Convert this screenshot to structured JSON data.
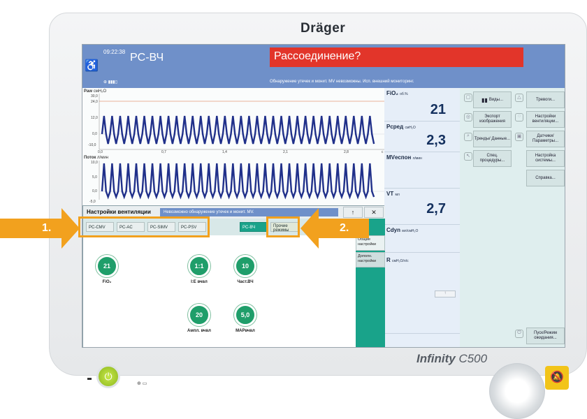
{
  "device": {
    "brand": "Dräger",
    "model_main": "Infinity",
    "model_sub": "C500"
  },
  "header": {
    "time": "09:22:38",
    "mode": "PC-ВЧ",
    "alarm": "Рассоединение?",
    "alarm_message": "Обнаружение утечек и монит. MV невозможны. Исп. внешний мониторинг."
  },
  "waves": {
    "paw_label": "Paw",
    "paw_unit": "смH₂O",
    "paw_ticks": [
      "30,0",
      "24,0",
      "12,0",
      "0,0",
      "-10,0"
    ],
    "time_ticks": [
      "0,0",
      "0,7",
      "1,4",
      "2,1",
      "2,8",
      "с"
    ],
    "flow_label": "Поток",
    "flow_unit": "л/мин",
    "flow_ticks": [
      "10,0",
      "5,0",
      "0,0",
      "-5,0"
    ]
  },
  "params": [
    {
      "name": "FiO₂",
      "unit": "об.%",
      "value": "21"
    },
    {
      "name": "Pсред",
      "unit": "смH₂O",
      "value": "2,3"
    },
    {
      "name": "MVеспон",
      "unit": "л/мин",
      "value": ""
    },
    {
      "name": "VT",
      "unit": "мл",
      "value": "2,7"
    },
    {
      "name": "Cdyn",
      "unit": "мл/смH₂O",
      "value": ""
    },
    {
      "name": "R",
      "unit": "смH₂O/л/с",
      "value": ""
    }
  ],
  "menu_left": [
    "Виды...",
    "Экспорт изображения",
    "Тренды/ Данные...",
    "Спец. процедуры..."
  ],
  "menu_right": [
    "Тревоги...",
    "Настройки вентиляции...",
    "Датчики/ Параметры...",
    "Настройка системы...",
    "Справка...",
    "Пуск/Режим ожидания..."
  ],
  "dialog": {
    "title": "Настройки вентиляции",
    "message": "Невозможно обнаружение утечек и монит. MV.",
    "up_btn": "↑",
    "close_btn": "✕",
    "tabs": [
      "PC-CMV",
      "PC-AC",
      "PC-SIMV",
      "PC-PSV"
    ],
    "active_tab": "PC-ВЧ",
    "other_modes": "Прочие режимы",
    "side_tabs": [
      "Общие настройки",
      "Дополн. настройки"
    ],
    "knobs": [
      {
        "value": "21",
        "label": "FiO₂"
      },
      {
        "value": "1:1",
        "label": "I:E вчвл"
      },
      {
        "value": "10",
        "label": "Част.ВЧ"
      },
      {
        "value": "20",
        "label": "Ампл. вчвл"
      },
      {
        "value": "5,0",
        "label": "MAPвчвл"
      }
    ]
  },
  "callouts": {
    "one": "1.",
    "two": "2."
  },
  "colors": {
    "header": "#6f90c9",
    "alarm": "#e2352a",
    "accent": "#19a38a",
    "callout": "#f2a11e",
    "wave": "#20308a"
  }
}
